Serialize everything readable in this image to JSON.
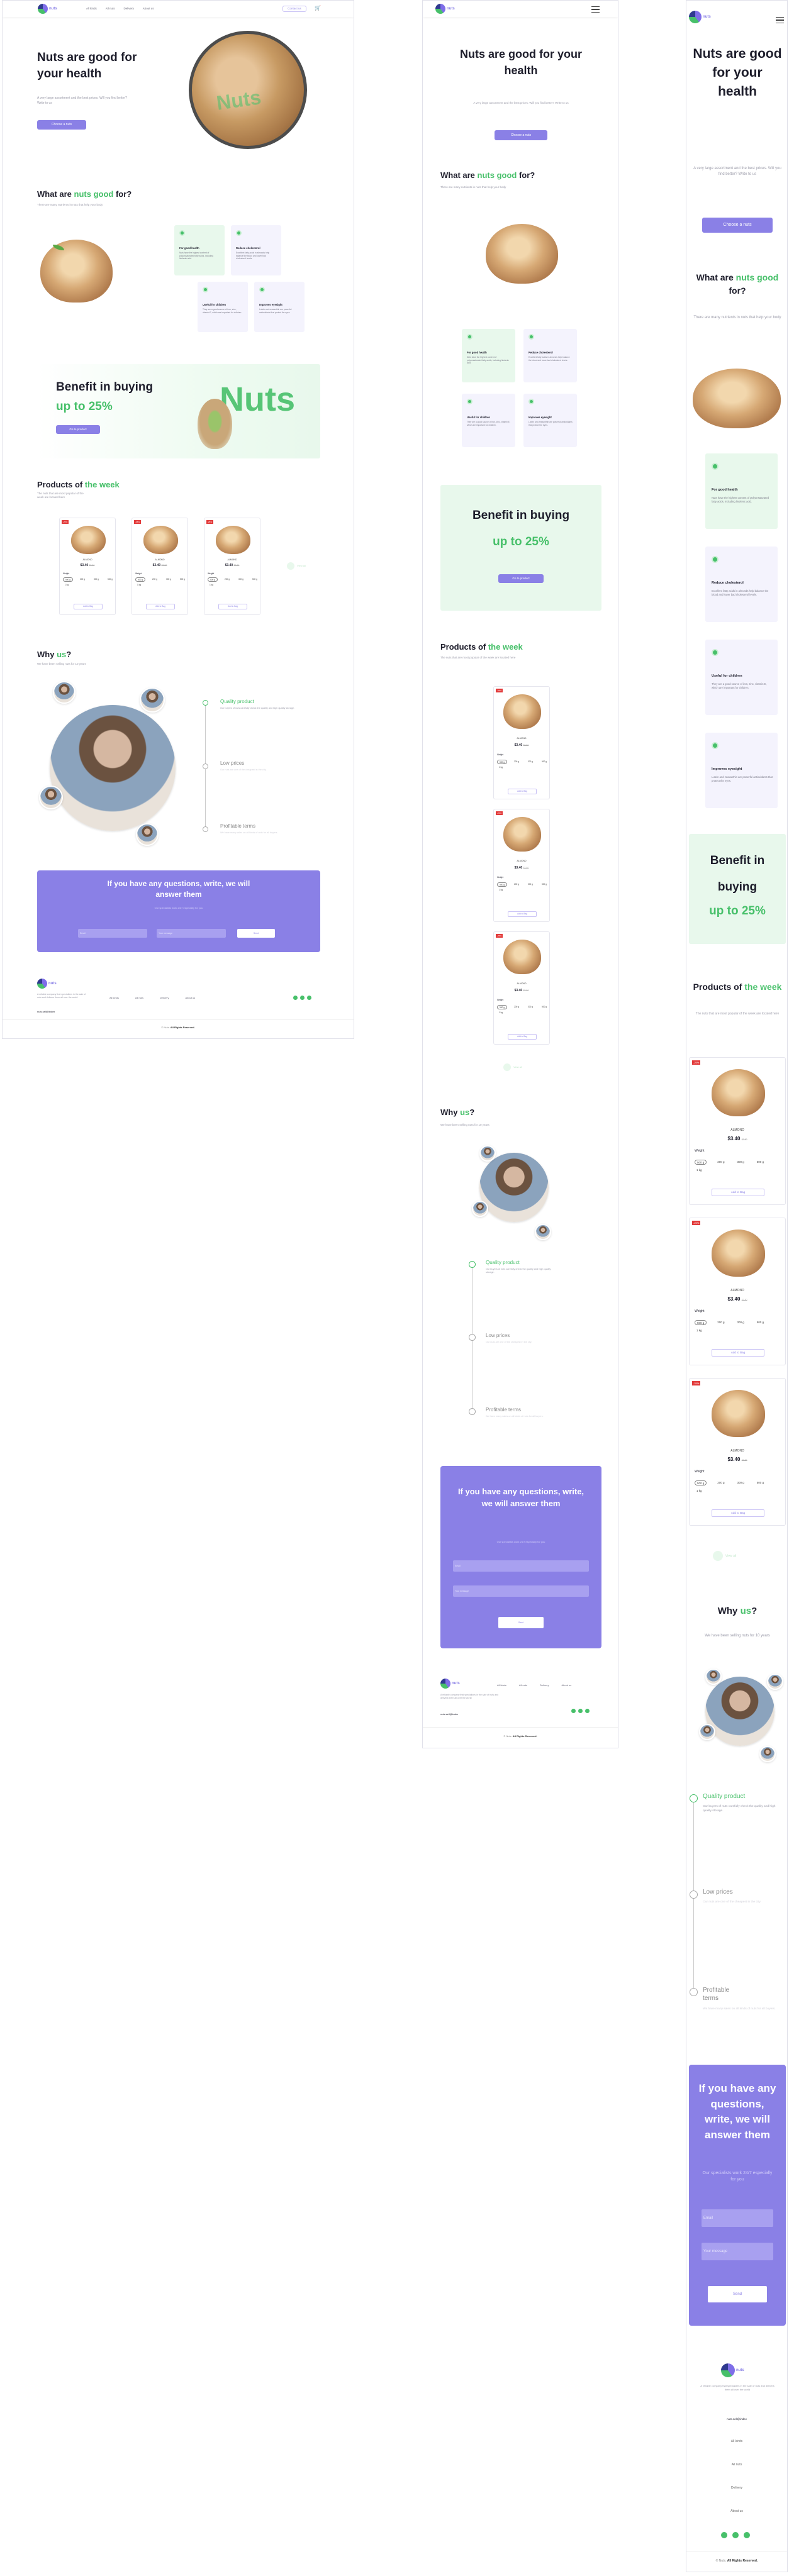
{
  "header": {
    "nav": [
      "All kinds",
      "All nuts",
      "Delivery",
      "About us"
    ],
    "contact_button": "Contact us",
    "logo_text": "nuts"
  },
  "hero": {
    "title": "Nuts are good for your health",
    "subtitle": "A very large assortment and the best prices. Will you find better? Write to us",
    "button": "Choose a nuts"
  },
  "what": {
    "title_pre": "What are ",
    "title_green": "nuts good",
    "title_post": " for?",
    "subtitle": "There are many nutrients in nuts that help your body",
    "cards": [
      {
        "title": "For good health",
        "text": "Nuts have the highest content of polyunsaturated fatty acids, including linolenic acid."
      },
      {
        "title": "Reduce cholesterol",
        "text": "Excellent fatty acids in almonds help balance the blood and lower bad cholesterol levels."
      },
      {
        "title": "Useful for children",
        "text": "They are a good source of iron, zinc, vitamin E, which are important for children."
      },
      {
        "title": "Improves eyesight",
        "text": "Lutein and zeaxanthin are powerful antioxidants that protect the eyes."
      }
    ]
  },
  "benefit": {
    "line1": "Benefit in buying",
    "line2": "up to 25%",
    "button": "Go to product",
    "decor_word": "Nuts"
  },
  "products": {
    "title_pre": "Products of ",
    "title_green": "the week",
    "subtitle": "The nuts that are most popular of the week are located here",
    "items": [
      {
        "badge": "-25%",
        "name": "ALMOND",
        "price": "$3.40",
        "old_price": "$3.80",
        "weight_label": "Weight",
        "weights": [
          "500 g",
          "200 g",
          "300 g",
          "500 g",
          "1 kg"
        ],
        "button": "Add to Bag"
      },
      {
        "badge": "-25%",
        "name": "ALMOND",
        "price": "$3.40",
        "old_price": "$3.80",
        "weight_label": "Weight",
        "weights": [
          "500 g",
          "200 g",
          "300 g",
          "500 g",
          "1 kg"
        ],
        "button": "Add to Bag"
      },
      {
        "badge": "-25%",
        "name": "ALMOND",
        "price": "$3.40",
        "old_price": "$3.80",
        "weight_label": "Weight",
        "weights": [
          "500 g",
          "200 g",
          "300 g",
          "500 g",
          "1 kg"
        ],
        "button": "Add to Bag"
      }
    ],
    "more_link": "View all"
  },
  "why": {
    "title_pre": "Why ",
    "title_green": "us",
    "title_post": "?",
    "subtitle": "We have been selling nuts for 10 years",
    "items": [
      {
        "title": "Quality product",
        "text": "Our buyers of nuts carefully check the quality and high quality storage."
      },
      {
        "title": "Low prices",
        "text": "Our nuts are one of the cheapest in the city."
      },
      {
        "title": "Profitable terms",
        "text": "We have many sales on all kinds of nuts for all buyers."
      }
    ]
  },
  "contact": {
    "title": "If you have any questions, write, we will answer them",
    "subtitle": "Our specialists work 24/7 especially for you",
    "email_placeholder": "Email",
    "message_placeholder": "Your message",
    "send": "Send"
  },
  "footer": {
    "about": "A reliable company that specializes in the sale of nuts and delivers them all over the world",
    "email": "nuts.sell@index",
    "links": [
      "All kinds",
      "All nuts",
      "Delivery",
      "About us"
    ],
    "copyright_pre": "© Nuts. ",
    "copyright_bold": "All Rights Reserved."
  },
  "colors": {
    "accent_purple": "#8a80e6",
    "accent_green": "#47c06a",
    "sale_red": "#e23a3a"
  },
  "icons": [
    "cart-icon",
    "menu-icon",
    "check-icon",
    "social-icon"
  ]
}
